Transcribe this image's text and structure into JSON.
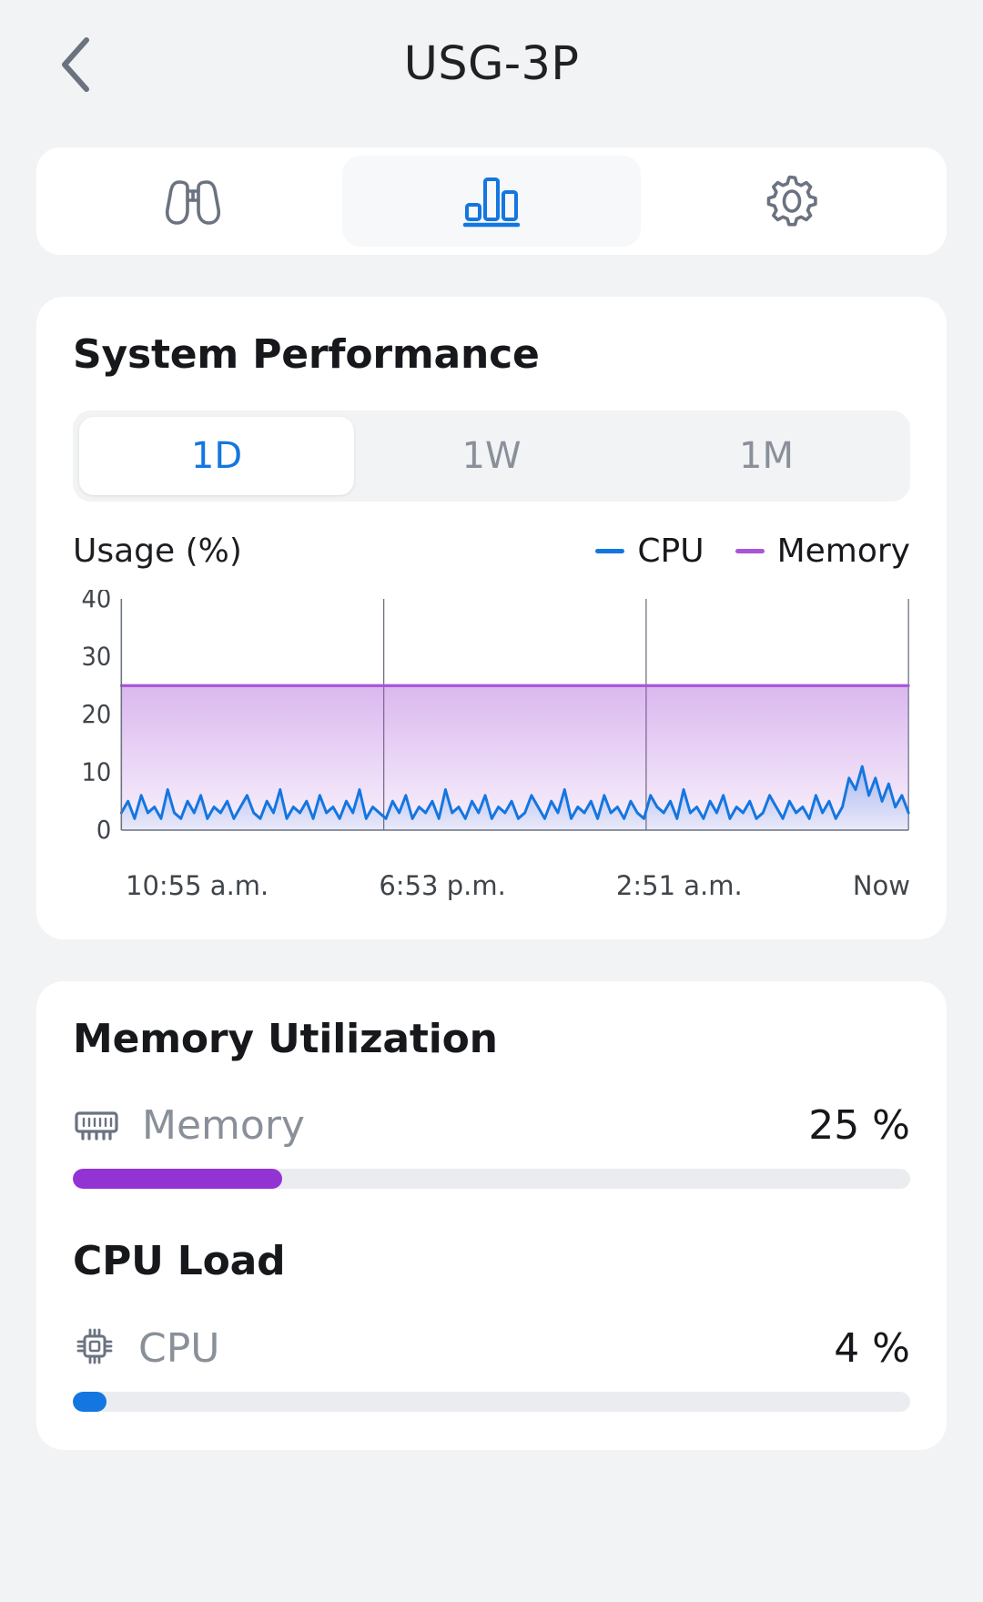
{
  "header": {
    "title": "USG-3P",
    "back_icon": "chevron-left-icon"
  },
  "tabs": [
    {
      "id": "overview",
      "icon": "binoculars-icon",
      "active": false
    },
    {
      "id": "statistics",
      "icon": "bar-chart-icon",
      "active": true
    },
    {
      "id": "settings",
      "icon": "gear-icon",
      "active": false
    }
  ],
  "performance": {
    "title": "System Performance",
    "ranges": [
      {
        "label": "1D",
        "active": true
      },
      {
        "label": "1W",
        "active": false
      },
      {
        "label": "1M",
        "active": false
      }
    ],
    "axis_caption": "Usage (%)",
    "legend": [
      {
        "label": "CPU",
        "color": "#1476e0"
      },
      {
        "label": "Memory",
        "color": "#a855d8"
      }
    ]
  },
  "memory_section": {
    "title": "Memory Utilization",
    "row": {
      "icon": "memory-stick-icon",
      "label": "Memory",
      "value": "25 %",
      "percent": 25,
      "color": "#9333d4"
    }
  },
  "cpu_section": {
    "title": "CPU Load",
    "row": {
      "icon": "cpu-chip-icon",
      "label": "CPU",
      "value": "4 %",
      "percent": 4,
      "color": "#1476e0"
    }
  },
  "colors": {
    "accent_blue": "#1476e0",
    "accent_purple": "#a855d8",
    "page_bg": "#f2f3f5",
    "card_bg": "#ffffff",
    "muted_text": "#8a9099"
  },
  "chart_data": {
    "type": "area",
    "title": "System Performance",
    "ylabel": "Usage (%)",
    "xlabel": "",
    "ylim": [
      0,
      40
    ],
    "yticks": [
      0,
      10,
      20,
      30,
      40
    ],
    "grid": "vertical",
    "legend_position": "top-right",
    "xticks": [
      "10:55 a.m.",
      "6:53 p.m.",
      "2:51 a.m.",
      "Now"
    ],
    "series": [
      {
        "name": "Memory",
        "color": "#a855d8",
        "fill": true,
        "constant": 25,
        "values": [
          25,
          25,
          25,
          25,
          25,
          25,
          25,
          25,
          25,
          25,
          25,
          25,
          25,
          25,
          25,
          25,
          25,
          25,
          25,
          25,
          25,
          25,
          25,
          25,
          25,
          25,
          25,
          25,
          25,
          25,
          25,
          25,
          25,
          25,
          25,
          25,
          25,
          25,
          25,
          25,
          25,
          25,
          25,
          25,
          25,
          25,
          25,
          25,
          25,
          25,
          25,
          25,
          25,
          25,
          25,
          25,
          25,
          25,
          25,
          25,
          25,
          25,
          25,
          25,
          25,
          25,
          25,
          25,
          25,
          25,
          25,
          25,
          25,
          25,
          25,
          25,
          25,
          25,
          25,
          25,
          25,
          25,
          25,
          25,
          25,
          25,
          25,
          25,
          25,
          25,
          25,
          25,
          25,
          25,
          25,
          25,
          25,
          25,
          25,
          25,
          25,
          25,
          25,
          25,
          25,
          25,
          25,
          25,
          25,
          25,
          25,
          25,
          25,
          25,
          25,
          25,
          25,
          25,
          25,
          25
        ]
      },
      {
        "name": "CPU",
        "color": "#1476e0",
        "fill": true,
        "values": [
          3,
          5,
          2,
          6,
          3,
          4,
          2,
          7,
          3,
          2,
          5,
          3,
          6,
          2,
          4,
          3,
          5,
          2,
          4,
          6,
          3,
          2,
          5,
          3,
          7,
          2,
          4,
          3,
          5,
          2,
          6,
          3,
          4,
          2,
          5,
          3,
          7,
          2,
          4,
          3,
          2,
          5,
          3,
          6,
          2,
          4,
          3,
          5,
          2,
          7,
          3,
          4,
          2,
          5,
          3,
          6,
          2,
          4,
          3,
          5,
          2,
          3,
          6,
          4,
          2,
          5,
          3,
          7,
          2,
          4,
          3,
          5,
          2,
          6,
          3,
          4,
          2,
          5,
          3,
          2,
          6,
          4,
          3,
          5,
          2,
          7,
          3,
          4,
          2,
          5,
          3,
          6,
          2,
          4,
          3,
          5,
          2,
          3,
          6,
          4,
          2,
          5,
          3,
          4,
          2,
          6,
          3,
          5,
          2,
          4,
          9,
          7,
          11,
          6,
          9,
          5,
          8,
          4,
          6,
          3
        ]
      }
    ]
  }
}
